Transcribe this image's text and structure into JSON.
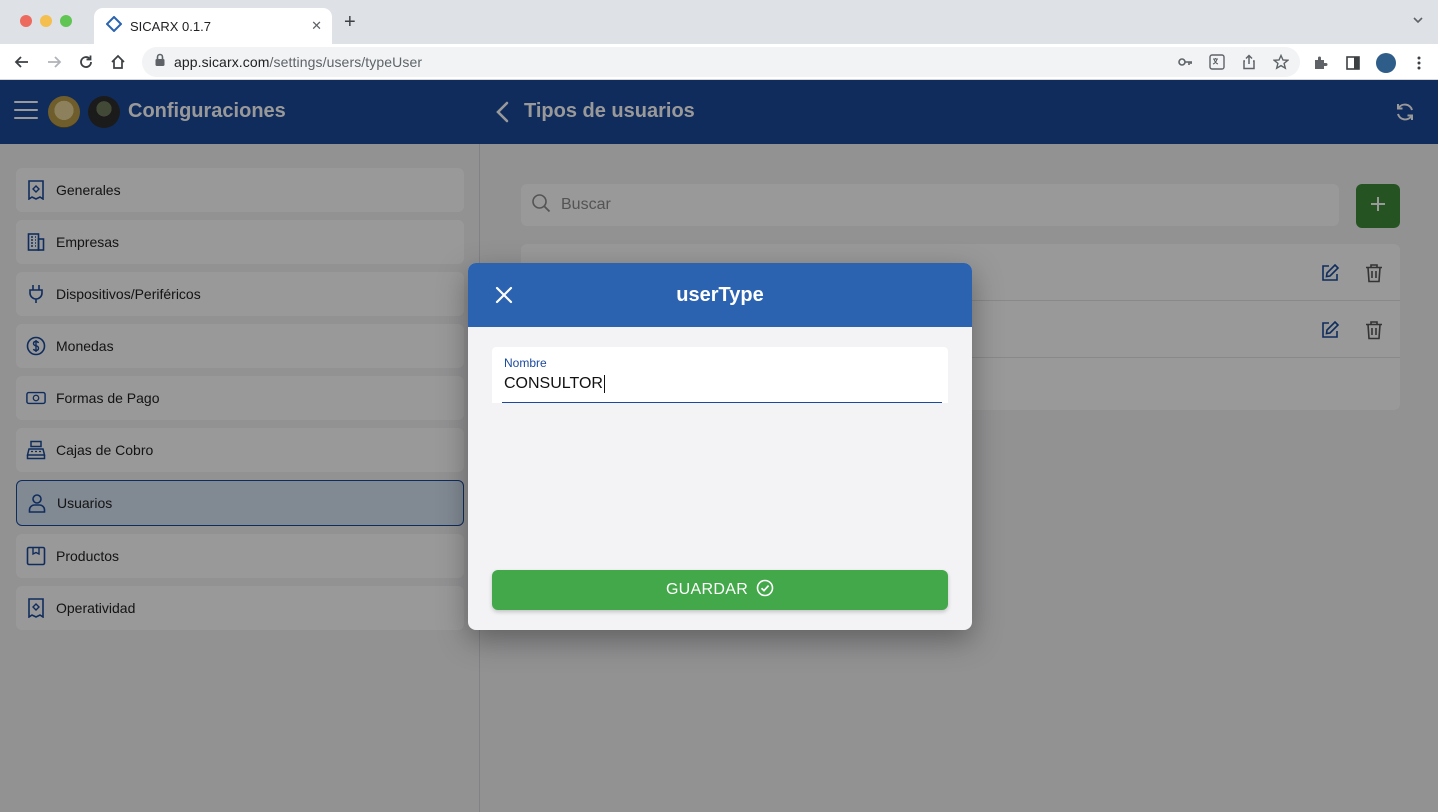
{
  "browser": {
    "tab_title": "SICARX 0.1.7",
    "tab_close": "✕",
    "new_tab": "+",
    "url_domain": "app.sicarx.com",
    "url_path": "/settings/users/typeUser"
  },
  "header": {
    "app_title": "Configuraciones",
    "page_title": "Tipos de usuarios"
  },
  "sidebar": {
    "items": [
      {
        "label": "Generales",
        "icon": "receipt-icon"
      },
      {
        "label": "Empresas",
        "icon": "building-icon"
      },
      {
        "label": "Dispositivos/Periféricos",
        "icon": "plug-icon"
      },
      {
        "label": "Monedas",
        "icon": "dollar-circle-icon"
      },
      {
        "label": "Formas de Pago",
        "icon": "banknote-icon"
      },
      {
        "label": "Cajas de Cobro",
        "icon": "cash-register-icon"
      },
      {
        "label": "Usuarios",
        "icon": "user-icon",
        "active": true
      },
      {
        "label": "Productos",
        "icon": "box-icon"
      },
      {
        "label": "Operatividad",
        "icon": "receipt-icon"
      }
    ]
  },
  "main": {
    "search_placeholder": "Buscar"
  },
  "modal": {
    "title": "userType",
    "field_label": "Nombre",
    "field_value": "CONSULTOR",
    "save_label": "GUARDAR"
  },
  "colors": {
    "header_blue": "#1b4a9c",
    "modal_header_blue": "#2b63b0",
    "save_green": "#43a84a",
    "add_green": "#3f8c3a"
  }
}
